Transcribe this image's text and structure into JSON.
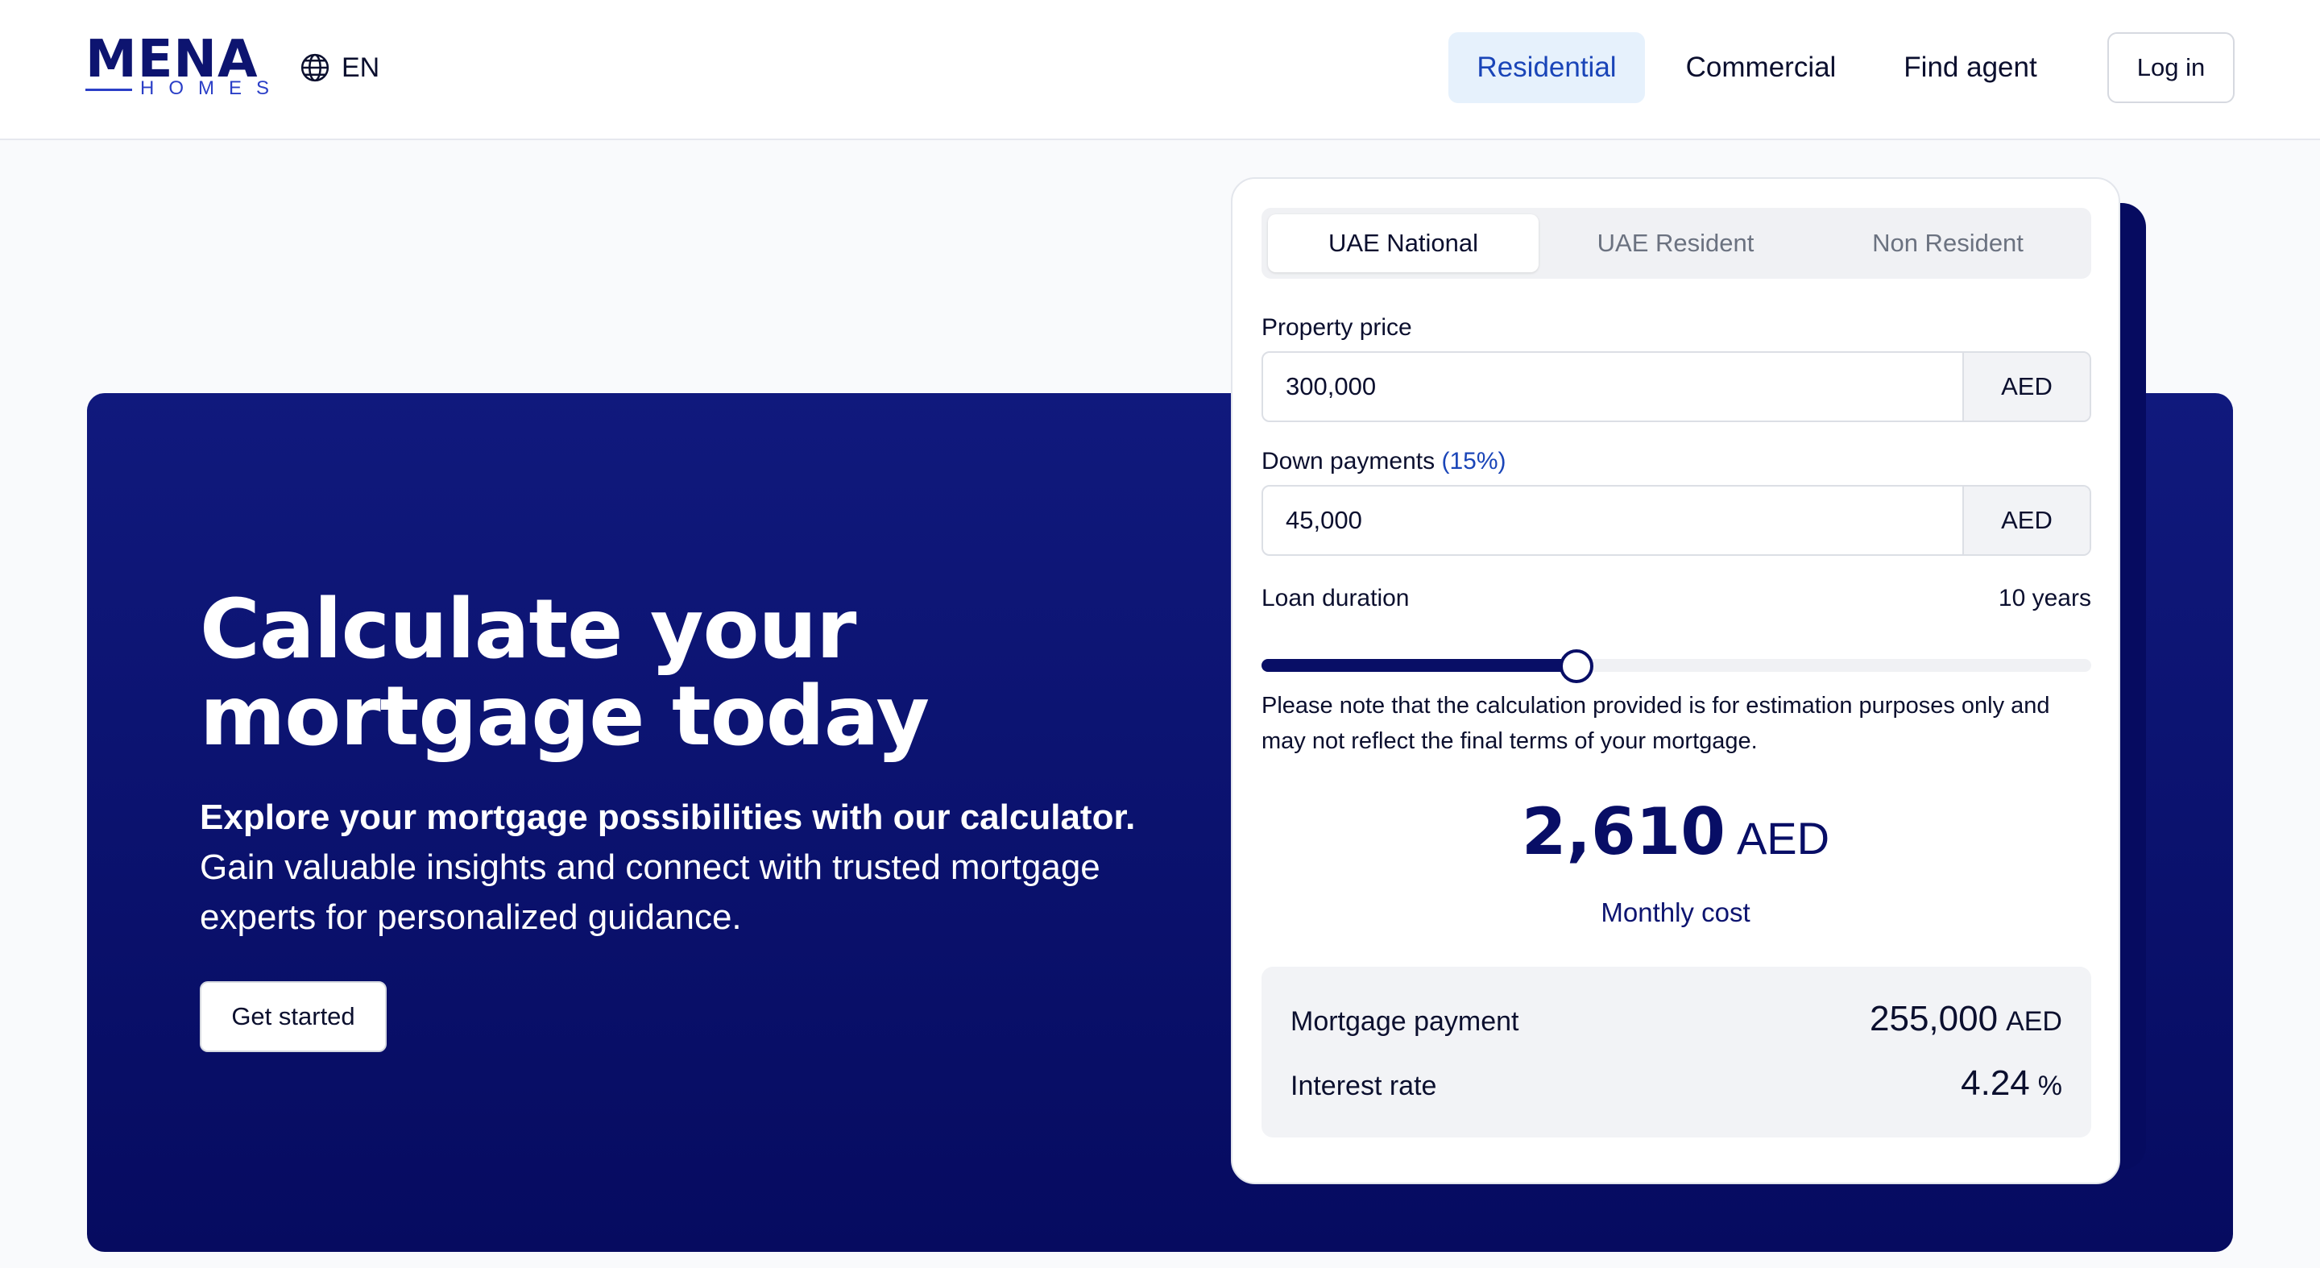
{
  "header": {
    "logo": {
      "word": "MENA",
      "sub": "HOMES"
    },
    "language": "EN",
    "nav": [
      {
        "label": "Residential",
        "active": true
      },
      {
        "label": "Commercial",
        "active": false
      },
      {
        "label": "Find agent",
        "active": false
      }
    ],
    "login_label": "Log in"
  },
  "hero": {
    "title_line1": "Calculate your",
    "title_line2": "mortgage today",
    "subtitle_bold": "Explore your mortgage possibilities with our calculator.",
    "subtitle_rest": "Gain valuable insights and connect with trusted mortgage experts for personalized guidance.",
    "cta_label": "Get started"
  },
  "calculator": {
    "tabs": [
      {
        "label": "UAE National",
        "selected": true
      },
      {
        "label": "UAE Resident",
        "selected": false
      },
      {
        "label": "Non Resident",
        "selected": false
      }
    ],
    "property_price": {
      "label": "Property price",
      "value": "300,000",
      "unit": "AED"
    },
    "down_payment": {
      "label": "Down payments",
      "percent": "(15%)",
      "value": "45,000",
      "unit": "AED"
    },
    "loan_duration": {
      "label": "Loan duration",
      "value": "10 years",
      "slider_fraction": 0.38
    },
    "note": "Please note that the calculation provided is for estimation purposes only and may not reflect the final terms of your mortgage.",
    "monthly": {
      "value": "2,610",
      "unit": "AED",
      "label": "Monthly cost"
    },
    "summary": {
      "mortgage_payment": {
        "label": "Mortgage payment",
        "value": "255,000",
        "unit": "AED"
      },
      "interest_rate": {
        "label": "Interest rate",
        "value": "4.24",
        "unit": "%"
      }
    }
  },
  "colors": {
    "brand_navy": "#080e66",
    "accent_blue": "#1a45b8",
    "nav_active_bg": "#e6f1fc"
  },
  "icons": {
    "language": "globe-icon"
  }
}
